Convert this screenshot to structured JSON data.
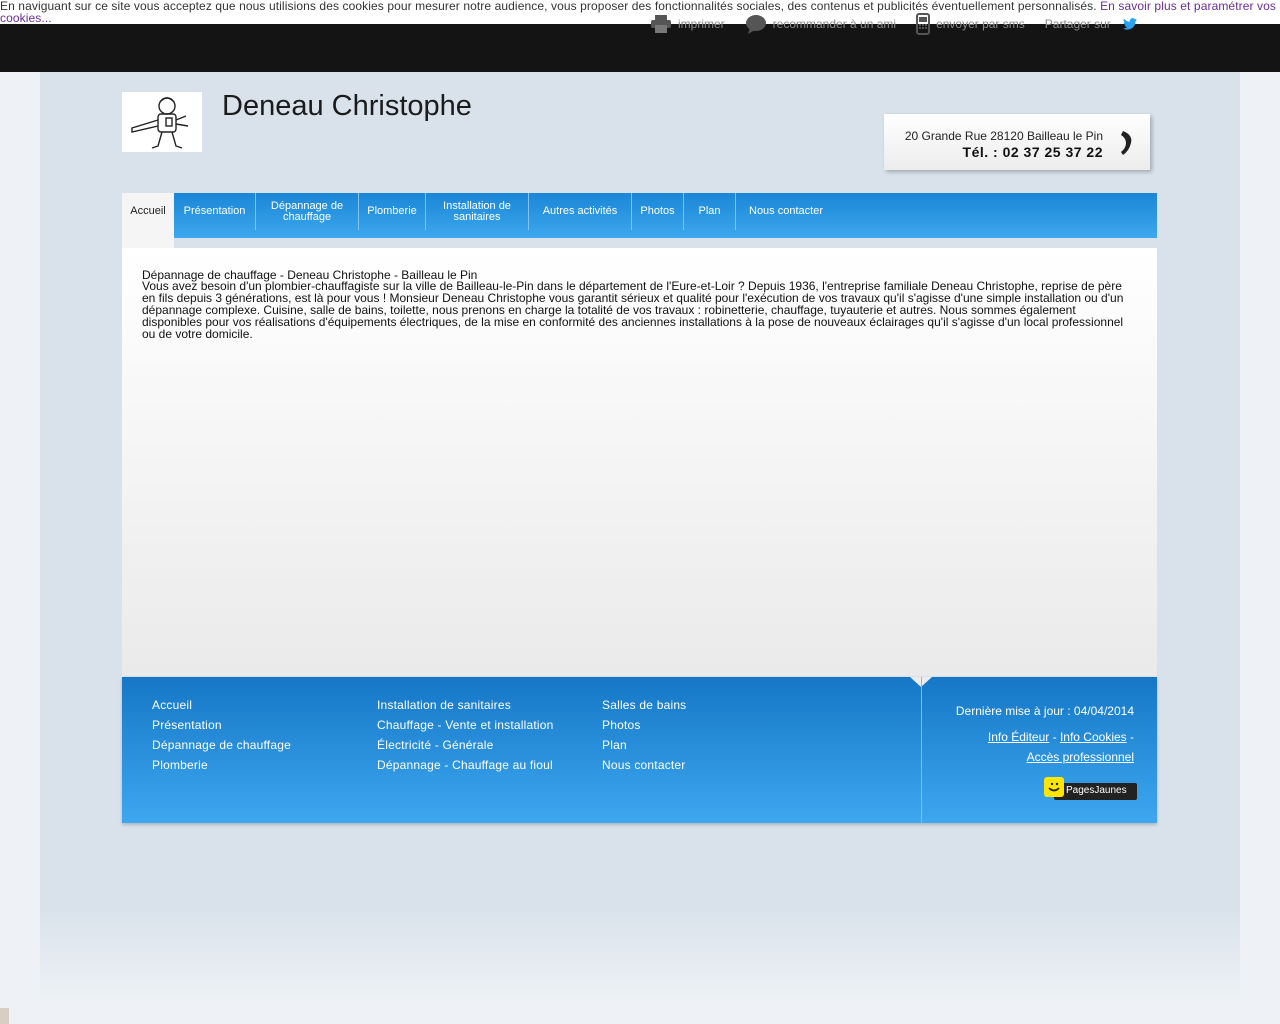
{
  "cookie_bar": {
    "text": "En naviguant sur ce site vous acceptez que nous utilisions des cookies pour mesurer notre audience, vous proposer des fonctionnalités sociales, des contenus et publicités éventuellement personnalisés.",
    "link": "En savoir plus et paramétrer vos cookies..."
  },
  "share_tools": {
    "print": "imprimer",
    "recommend": "recommander à un ami",
    "sms": "envoyer par sms",
    "share": "Partager sur"
  },
  "header": {
    "title": "Deneau Christophe",
    "address": "20 Grande Rue 28120 Bailleau le Pin",
    "phone": "Tél. : 02 37 25 37 22"
  },
  "nav": [
    {
      "label": "Accueil",
      "active": true
    },
    {
      "label": "Présentation"
    },
    {
      "label": "Dépannage de chauffage"
    },
    {
      "label": "Plomberie"
    },
    {
      "label": "Installation de sanitaires"
    },
    {
      "label": "Autres activités"
    },
    {
      "label": "Photos"
    },
    {
      "label": "Plan"
    },
    {
      "label": "Nous contacter"
    }
  ],
  "content": {
    "heading": "Dépannage de chauffage - Deneau Christophe - Bailleau le Pin",
    "body": "Vous avez besoin d'un plombier-chauffagiste sur la ville de Bailleau-le-Pin dans le département de l'Eure-et-Loir ? Depuis 1936, l'entreprise familiale Deneau Christophe, reprise de père en fils depuis 3 générations, est là pour vous ! Monsieur Deneau Christophe vous garantit sérieux et qualité pour l'exécution de vos travaux qu'il s'agisse d'une simple installation ou d'un dépannage complexe. Cuisine, salle de bains, toilette, nous prenons en charge la totalité de vos travaux : robinetterie, chauffage, tuyauterie et autres. Nous sommes également disponibles pour vos réalisations d'équipements électriques, de la mise en conformité des anciennes installations à la pose de nouveaux éclairages qu'il s'agisse d'un local professionnel ou de votre domicile."
  },
  "footer": {
    "col1": [
      "Accueil",
      "Présentation",
      "Dépannage de chauffage",
      "Plomberie"
    ],
    "col2": [
      "Installation de sanitaires",
      "Chauffage - Vente et installation",
      "Électricité - Générale",
      "Dépannage - Chauffage au fioul"
    ],
    "col3": [
      "Salles de bains",
      "Photos",
      "Plan",
      "Nous contacter"
    ],
    "last_update": "Dernière mise à jour : 04/04/2014",
    "info_editeur": "Info Éditeur",
    "info_cookies": "Info Cookies",
    "acces_pro": "Accès professionnel",
    "badge": "PagesJaunes"
  },
  "colors": {
    "nav_blue": "#1a86d6",
    "topbar": "#141414",
    "cookie_link": "#6a2d9a",
    "twitter": "#2aa3ef",
    "badge_yellow": "#ffe600"
  }
}
